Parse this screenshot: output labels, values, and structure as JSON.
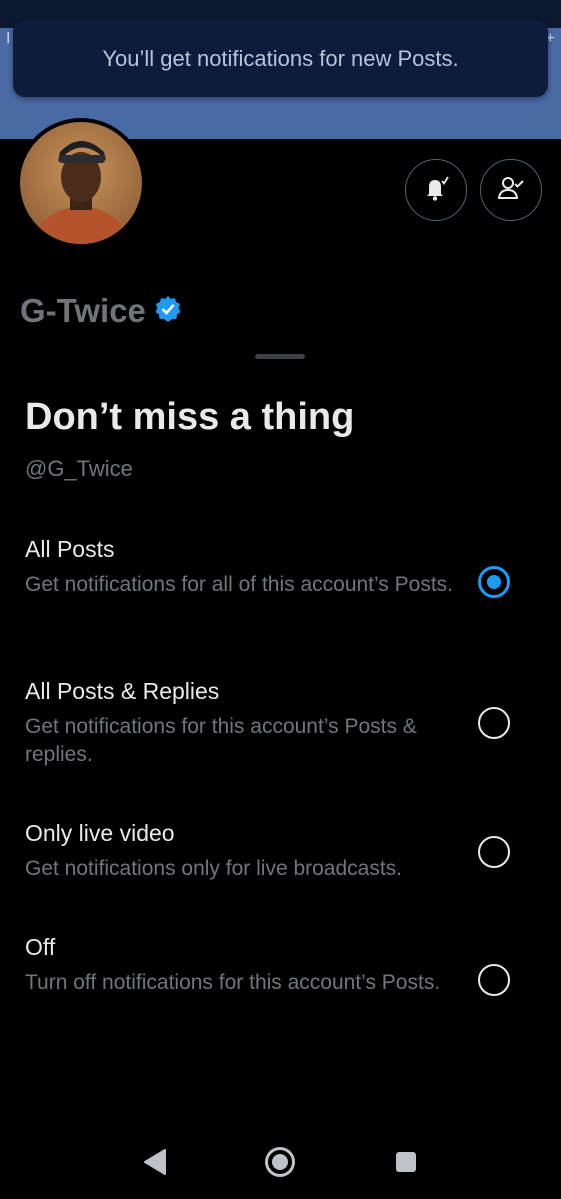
{
  "toast": {
    "message": "You’ll get notifications for new Posts."
  },
  "status_bar": {
    "left_glyph": "I",
    "right_glyph": "+"
  },
  "profile": {
    "name": "G-Twice",
    "verified": true
  },
  "sheet": {
    "title": "Don’t miss a thing",
    "handle": "@G_Twice",
    "options": [
      {
        "title": "All Posts",
        "description": "Get notifications for all of this account’s Posts.",
        "selected": true
      },
      {
        "title": "All Posts & Replies",
        "description": "Get notifications for this account’s Posts & replies.",
        "selected": false
      },
      {
        "title": "Only live video",
        "description": "Get notifications only for live broadcasts.",
        "selected": false
      },
      {
        "title": "Off",
        "description": "Turn off notifications for this account’s Posts.",
        "selected": false
      }
    ]
  },
  "icons": {
    "bell": "bell-check-icon",
    "follow": "person-check-icon",
    "verified": "verified-badge-icon",
    "nav_back": "back-triangle-icon",
    "nav_home": "home-circle-icon",
    "nav_recent": "recents-square-icon"
  },
  "colors": {
    "accent": "#1d9bf0",
    "banner": "#4a6aa6",
    "background": "#000000",
    "muted_text": "#71767b"
  }
}
